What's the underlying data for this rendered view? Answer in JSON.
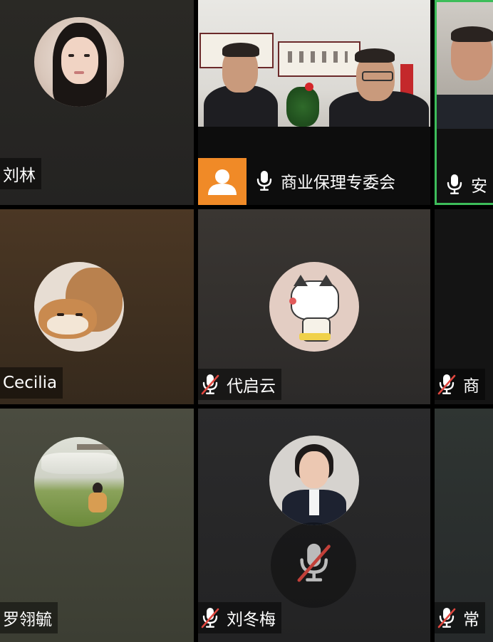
{
  "participants": [
    {
      "id": "r0c0",
      "name": "刘林",
      "muted": false
    },
    {
      "id": "r0c1",
      "name": "商业保理专委会",
      "muted": false,
      "speaking_video": true
    },
    {
      "id": "r0c2",
      "name": "安",
      "muted": false,
      "active_speaker": true
    },
    {
      "id": "r1c0",
      "name": "Cecilia",
      "muted": false
    },
    {
      "id": "r1c1",
      "name": "代启云",
      "muted": true
    },
    {
      "id": "r1c2",
      "name": "商",
      "muted": true
    },
    {
      "id": "r2c0",
      "name": "罗翎毓",
      "muted": false
    },
    {
      "id": "r2c1",
      "name": "刘冬梅",
      "muted": true
    },
    {
      "id": "r2c2",
      "name": "常",
      "muted": true
    }
  ],
  "colors": {
    "active_border": "#3dbd5a",
    "host_badge": "#f08a27",
    "mute_slash": "#e0473f"
  },
  "icons": {
    "mic": "microphone-icon",
    "mic_muted": "microphone-muted-icon",
    "user": "user-placeholder-icon"
  }
}
